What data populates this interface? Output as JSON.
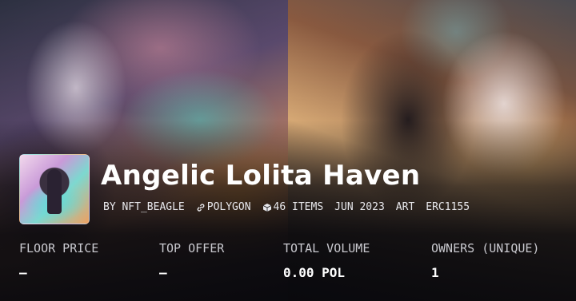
{
  "collection": {
    "title": "Angelic Lolita Haven",
    "creator": "BY NFT_BEAGLE",
    "chain": "POLYGON",
    "items": "46 ITEMS",
    "date": "JUN 2023",
    "category": "ART",
    "standard": "ERC1155",
    "chain_icon": "link-icon",
    "items_icon": "cube-icon"
  },
  "stats": [
    {
      "label": "FLOOR PRICE",
      "value": "–"
    },
    {
      "label": "TOP OFFER",
      "value": "–"
    },
    {
      "label": "TOTAL VOLUME",
      "value": "0.00 POL"
    },
    {
      "label": "OWNERS (UNIQUE)",
      "value": "1"
    }
  ]
}
